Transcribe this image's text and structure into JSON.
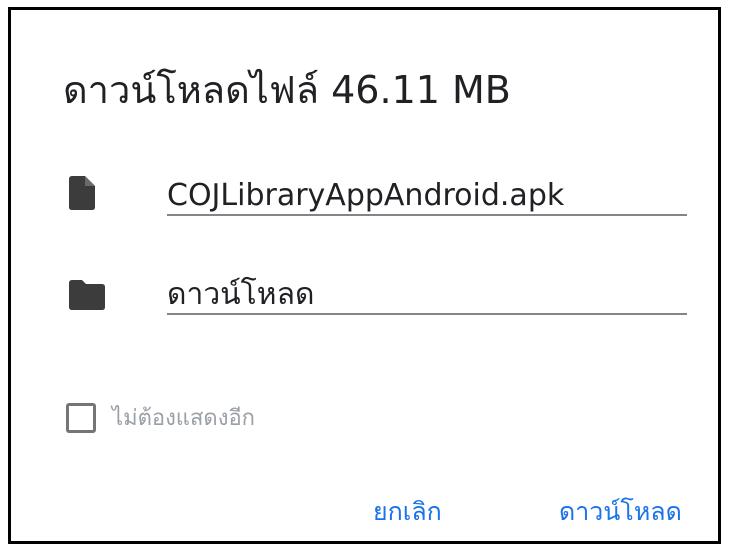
{
  "dialog": {
    "title": "ดาวน์โหลดไฟล์ 46.11 MB",
    "filename": {
      "icon": "file-icon",
      "value": "COJLibraryAppAndroid.apk"
    },
    "location": {
      "icon": "folder-icon",
      "value": "ดาวน์โหลด"
    },
    "dont_show_again": {
      "label": "ไม่ต้องแสดงอีก",
      "checked": false
    },
    "buttons": {
      "cancel": "ยกเลิก",
      "download": "ดาวน์โหลด"
    },
    "colors": {
      "accent": "#1a73e8",
      "text": "#202124",
      "icon": "#3c3c3c",
      "muted": "#9aa0a6",
      "underline": "#80868b"
    }
  }
}
